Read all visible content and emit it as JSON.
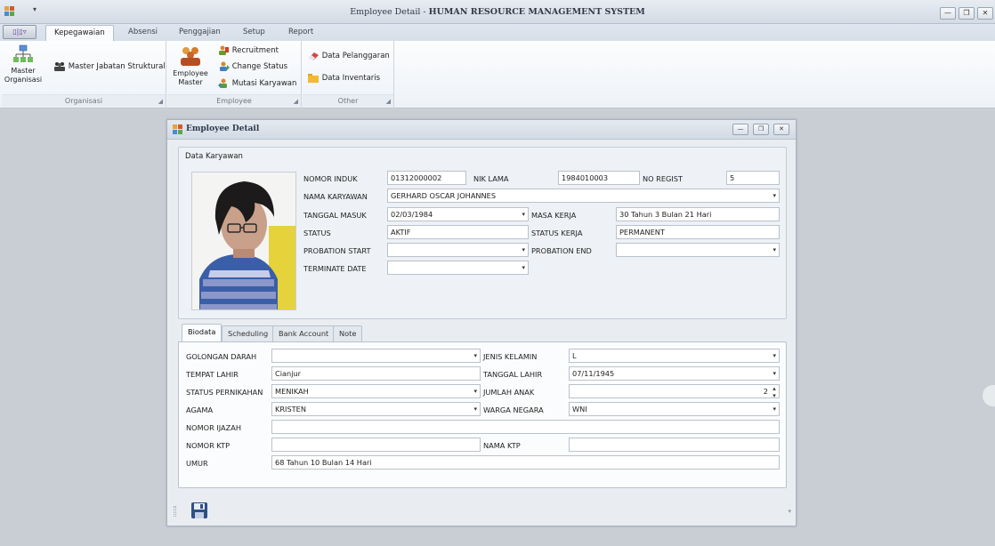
{
  "window": {
    "title_app": "Employee Detail - ",
    "title_system": "HUMAN RESOURCE MANAGEMENT SYSTEM",
    "quick_access_dropdown": "▾"
  },
  "ribbon": {
    "app_button": "▯|▯▿",
    "tabs": [
      {
        "label": "Kepegawaian",
        "active": true
      },
      {
        "label": "Absensi",
        "active": false
      },
      {
        "label": "Penggajian",
        "active": false
      },
      {
        "label": "Setup",
        "active": false
      },
      {
        "label": "Report",
        "active": false
      }
    ],
    "groups": {
      "organisasi": {
        "label": "Organisasi",
        "master_organisasi": "Master\nOrganisasi",
        "master_jabatan": "Master Jabatan Struktural"
      },
      "employee": {
        "label": "Employee",
        "employee_master": "Employee\nMaster",
        "recruitment": "Recruitment",
        "change_status": "Change Status",
        "mutasi": "Mutasi Karyawan"
      },
      "other": {
        "label": "Other",
        "data_pelanggaran": "Data Pelanggaran",
        "data_inventaris": "Data Inventaris"
      }
    }
  },
  "employee_window": {
    "title": "Employee Detail",
    "group_caption": "Data Karyawan",
    "fields": {
      "nomor_induk": {
        "label": "NOMOR INDUK",
        "value": "01312000002"
      },
      "nik_lama": {
        "label": "NIK LAMA",
        "value": "1984010003"
      },
      "no_regist": {
        "label": "NO REGIST",
        "value": "5"
      },
      "nama_karyawan": {
        "label": "NAMA KARYAWAN",
        "value": "GERHARD OSCAR JOHANNES"
      },
      "tanggal_masuk": {
        "label": "TANGGAL MASUK",
        "value": "02/03/1984"
      },
      "masa_kerja": {
        "label": "MASA KERJA",
        "value": "30 Tahun 3 Bulan 21 Hari"
      },
      "status": {
        "label": "STATUS",
        "value": "AKTIF"
      },
      "status_kerja": {
        "label": "STATUS KERJA",
        "value": "PERMANENT"
      },
      "probation_start": {
        "label": "PROBATION START",
        "value": ""
      },
      "probation_end": {
        "label": "PROBATION END",
        "value": ""
      },
      "terminate_date": {
        "label": "TERMINATE DATE",
        "value": ""
      }
    },
    "detail_tabs": [
      {
        "label": "Biodata",
        "active": true
      },
      {
        "label": "Scheduling",
        "active": false
      },
      {
        "label": "Bank Account",
        "active": false
      },
      {
        "label": "Note",
        "active": false
      }
    ],
    "biodata": {
      "golongan_darah": {
        "label": "GOLONGAN DARAH",
        "value": ""
      },
      "jenis_kelamin": {
        "label": "JENIS KELAMIN",
        "value": "L"
      },
      "tempat_lahir": {
        "label": "TEMPAT LAHIR",
        "value": "Cianjur"
      },
      "tanggal_lahir": {
        "label": "TANGGAL LAHIR",
        "value": "07/11/1945"
      },
      "status_pernikahan": {
        "label": "STATUS PERNIKAHAN",
        "value": "MENIKAH"
      },
      "jumlah_anak": {
        "label": "JUMLAH ANAK",
        "value": "2"
      },
      "agama": {
        "label": "AGAMA",
        "value": "KRISTEN"
      },
      "warga_negara": {
        "label": "WARGA NEGARA",
        "value": "WNI"
      },
      "nomor_ijazah": {
        "label": "NOMOR IJAZAH",
        "value": ""
      },
      "nomor_ktp": {
        "label": "NOMOR KTP",
        "value": ""
      },
      "nama_ktp": {
        "label": "NAMA KTP",
        "value": ""
      },
      "umur": {
        "label": "UMUR",
        "value": "68 Tahun 10 Bulan 14 Hari"
      }
    }
  },
  "icons": {
    "dropdown_arrow": "▾",
    "spin_arrows": "▴▾",
    "win_min": "—",
    "win_restore": "❐",
    "win_close": "✕",
    "dialog_launcher": "◢"
  },
  "colors": {
    "ribbon_bg": "#f4f7fb",
    "mdi_bg": "#c9ced4",
    "window_bg": "#e9edf2",
    "field_border": "#b9c2cd"
  }
}
